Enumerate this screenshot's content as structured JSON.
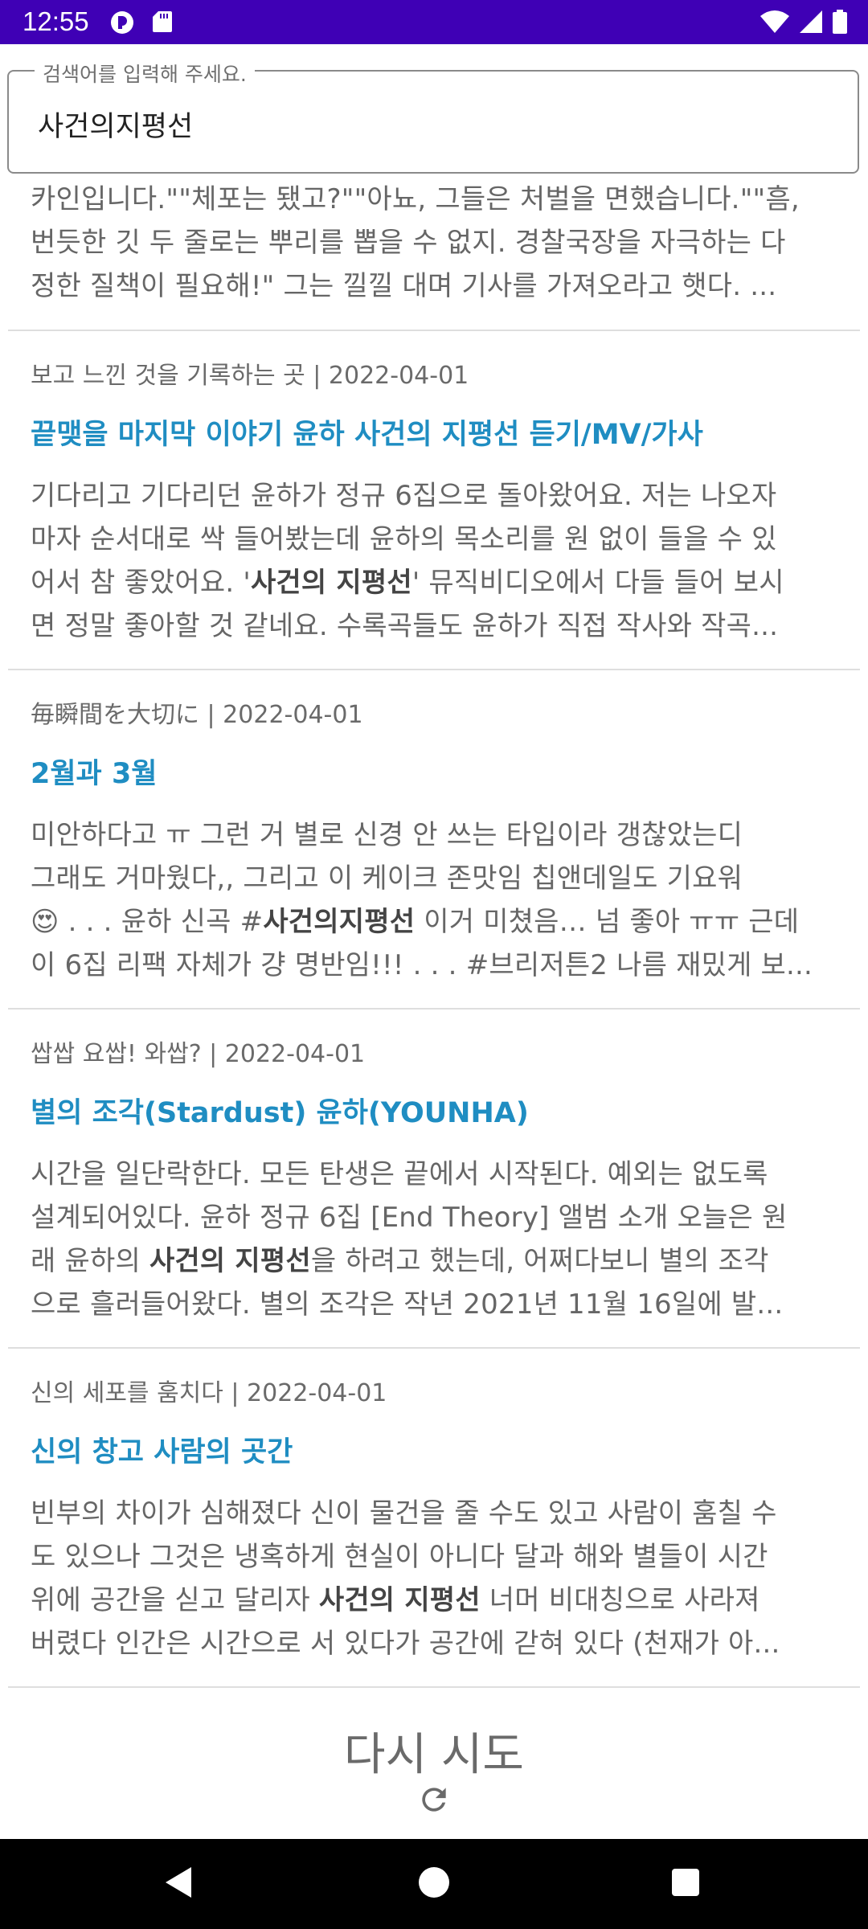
{
  "status_bar": {
    "time": "12:55",
    "background": "#3f00b5",
    "icons": [
      "app-icon",
      "sd-card-icon",
      "wifi-icon",
      "signal-icon",
      "battery-icon"
    ]
  },
  "search": {
    "label": "검색어를 입력해 주세요.",
    "value": "사건의지평선"
  },
  "top_snippet": {
    "line1": "카인입니다.\"\"체포는 됐고?\"\"아뇨, 그들은 처벌을 면했습니다.\"\"흠,",
    "line2": "번듯한 깃 두 줄로는 뿌리를 뽑을 수 없지. 경찰국장을 자극하는 다",
    "line3": "정한 질책이 필요해!\" 그는 낄낄 대며 기사를 가져오라고 햇다. ..."
  },
  "results": [
    {
      "meta": "보고 느낀 것을 기록하는 곳 | 2022-04-01",
      "title": "끝맺을 마지막 이야기 윤하 사건의 지평선 듣기/MV/가사",
      "l1": "기다리고 기다리던 윤하가 정규 6집으로 돌아왔어요. 저는 나오자",
      "l2": "마자 순서대로 싹 들어봤는데 윤하의 목소리를 원 없이 들을 수 있",
      "l3a": "어서 참 좋았어요. '",
      "l3b": "사건의 지평선",
      "l3c": "' 뮤직비디오에서 다들 들어 보시",
      "l4": "면 정말 좋아할 것 같네요. 수록곡들도 윤하가 직접 작사와 작곡..."
    },
    {
      "meta": "毎瞬間を大切に | 2022-04-01",
      "title": "2월과 3월",
      "l1": "미안하다고 ㅠ 그런 거 별로 신경 안 쓰는 타입이라 갱찮았는디",
      "l2": "그래도 거마웠다,, 그리고 이 케이크 존맛임 칩앤데일도 기요워",
      "l3a": "😍 . . . 윤하 신곡 #",
      "l3b": "사건의지평선",
      "l3c": " 이거 미쳤음… 넘 좋아 ㅠㅠ 근데",
      "l4": "이 6집 리팩 자체가 걍 명반임!!! . . . #브리저튼2 나름 재밌게 보..."
    },
    {
      "meta": "쌉쌉 요쌉! 와쌉? | 2022-04-01",
      "title": "별의 조각(Stardust) 윤하(YOUNHA)",
      "l1": "시간을 일단락한다. 모든 탄생은 끝에서 시작된다. 예외는 없도록",
      "l2": "설계되어있다.  윤하 정규 6집 [End Theory] 앨범 소개   오늘은 원",
      "l3a": "래 윤하의 ",
      "l3b": "사건의 지평선",
      "l3c": "을 하려고 했는데, 어쩌다보니 별의 조각",
      "l4": "으로 흘러들어왔다. 별의 조각은 작년 2021년 11월 16일에 발..."
    },
    {
      "meta": "신의 세포를 훔치다 | 2022-04-01",
      "title": "신의 창고 사람의 곳간",
      "l1": "빈부의 차이가 심해졌다  신이 물건을 줄 수도 있고 사람이 훔칠 수",
      "l2": "도 있으나 그것은 냉혹하게 현실이 아니다  달과 해와 별들이 시간",
      "l3a": "위에 공간을 싣고 달리자 ",
      "l3b": "사건의 지평선",
      "l3c": " 너머 비대칭으로 사라져",
      "l4": "버렸다  인간은 시간으로 서 있다가 공간에 갇혀 있다 (천재가 아..."
    }
  ],
  "retry": {
    "label": "다시 시도",
    "icon": "refresh-icon"
  },
  "nav_bar": {
    "icons": [
      "back-icon",
      "home-icon",
      "recents-icon"
    ]
  },
  "colors": {
    "accent_title": "#1f8dc2",
    "status_bar": "#3f00b5"
  }
}
